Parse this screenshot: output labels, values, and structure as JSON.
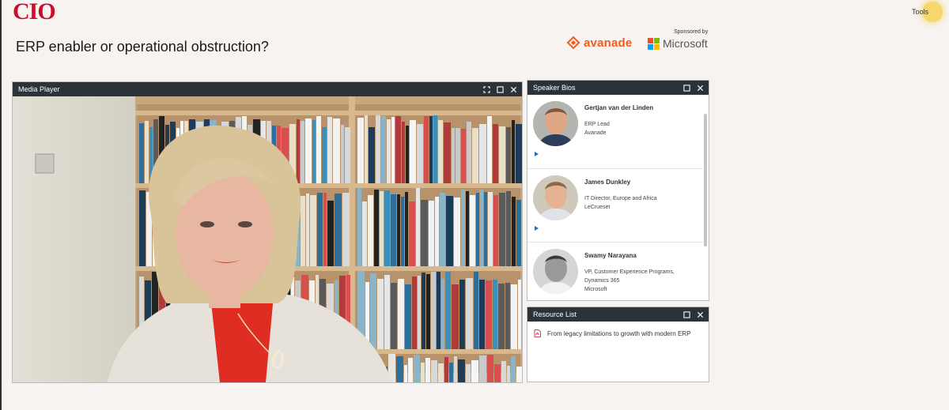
{
  "brand": {
    "logo_text": "CIO"
  },
  "tools": {
    "label": "Tools"
  },
  "page": {
    "title": "ERP enabler or operational obstruction?"
  },
  "sponsors": {
    "label": "Sponsored by",
    "logos": [
      "avanade",
      "Microsoft"
    ]
  },
  "media_player": {
    "title": "Media Player",
    "controls": [
      "fullscreen-icon",
      "maximize-icon",
      "close-icon"
    ]
  },
  "speaker_bios": {
    "title": "Speaker Bios",
    "controls": [
      "maximize-icon",
      "close-icon"
    ],
    "speakers": [
      {
        "name": "Gertjan van der Linden",
        "role": "ERP Lead",
        "company": "Avanade"
      },
      {
        "name": "James Dunkley",
        "role": "IT Director, Europe and Africa",
        "company": "LeCrueset"
      },
      {
        "name": "Swamy Narayana",
        "role": "VP, Customer Experience Programs, Dynamics 365",
        "company": "Microsoft"
      }
    ]
  },
  "resource_list": {
    "title": "Resource List",
    "controls": [
      "maximize-icon",
      "close-icon"
    ],
    "items": [
      {
        "label": "From legacy limitations to growth with modern ERP",
        "icon": "pdf-icon"
      }
    ]
  },
  "colors": {
    "brand_red": "#c8102e",
    "avanade_orange": "#f25c1c",
    "panel_header": "#2b3238",
    "play_arrow": "#1f6fb2",
    "tools_yellow": "#f5d76e"
  }
}
